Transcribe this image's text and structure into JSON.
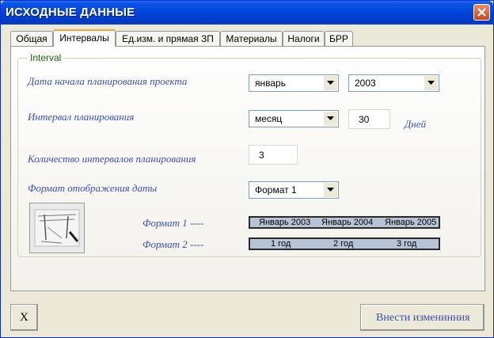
{
  "window": {
    "title": "ИСХОДНЫЕ ДАННЫЕ"
  },
  "tabs": [
    "Общая",
    "Интервалы",
    "Ед.изм. и прямая ЗП",
    "Материалы",
    "Налоги",
    "БРР"
  ],
  "active_tab": "Интервалы",
  "group": {
    "legend": "Interval"
  },
  "fields": {
    "start_label": "Дата начала планирования проекта",
    "start_month": "январь",
    "start_year": "2003",
    "interval_label": "Интервал планирования",
    "interval_unit": "месяц",
    "interval_days": "30",
    "days_label": "Дней",
    "count_label": "Количество интервалов планирования",
    "count_value": "3",
    "format_label": "Формат отображения даты",
    "format_value": "Формат 1"
  },
  "formats": {
    "format1_label": "Формат 1 ----",
    "format2_label": "Формат 2 ----",
    "format1_items": [
      "Январь 2003",
      "Январь 2004",
      "Январь 2005"
    ],
    "format2_items": [
      "1 год",
      "2 год",
      "3 год"
    ]
  },
  "buttons": {
    "close_label": "X",
    "apply_label": "Внести изменинния"
  },
  "colors": {
    "label": "#3a4fb4",
    "legend": "#1a6b1a",
    "titlebar": "#0043d8"
  }
}
